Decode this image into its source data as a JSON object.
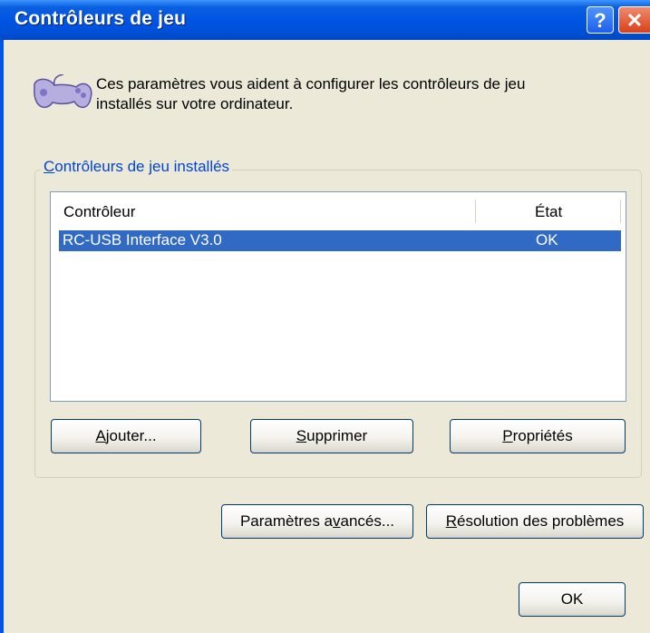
{
  "window": {
    "title": "Contrôleurs de jeu",
    "help_glyph": "?",
    "close_glyph": "✕"
  },
  "intro": {
    "line1": "Ces paramètres vous aident à configurer les contrôleurs de jeu",
    "line2": "installés sur votre ordinateur.",
    "icon": "gamepad-icon"
  },
  "group": {
    "title_accel": "C",
    "title_rest": "ontrôleurs de jeu installés"
  },
  "list": {
    "columns": [
      "Contrôleur",
      "État"
    ],
    "rows": [
      {
        "controller": "RC-USB Interface V3.0",
        "state": "OK",
        "selected": true
      }
    ]
  },
  "buttons": {
    "add": {
      "accel": "A",
      "rest": "jouter..."
    },
    "remove": {
      "accel": "S",
      "rest": "upprimer"
    },
    "properties": {
      "accel": "P",
      "rest": "ropriétés"
    },
    "advanced": {
      "pre": "Paramètres a",
      "accel": "v",
      "post": "ancés..."
    },
    "troubleshoot": {
      "accel": "R",
      "rest": "ésolution des problèmes"
    },
    "ok": "OK"
  },
  "colors": {
    "titlebar": "#0054e3",
    "selection": "#316ac5",
    "group_title": "#0046d5",
    "window_bg": "#ece9d8"
  }
}
